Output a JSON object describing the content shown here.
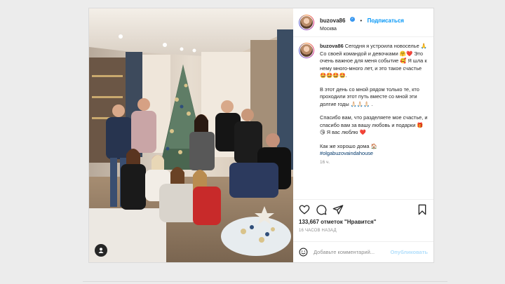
{
  "header": {
    "username": "buzova86",
    "dot": "•",
    "follow_label": "Подписаться",
    "location": "Москва"
  },
  "caption": {
    "username": "buzova86",
    "p1": "Сегодня я устроила новоселье 🙏 Со своей командой и девочками 🤗❤️ Это очень важное для меня событие 🥰 Я шла к нему много-много лет, и это такое счастье 🤩🤩🤩🤩.",
    "p2": "В этот день со мной рядом только те, кто проходили этот путь вместе со мной эти долгие годы 🙏🏻🙏🏻🙏🏻 .",
    "p3": "Спасибо вам, что разделяете мое счастье, и спасибо вам за вашу любовь и подарки 🎁😘 Я вас люблю ❤️",
    "p4": "Как же хорошо дома 🏠",
    "hashtag": "#olgabuzovaindahouse",
    "time": "16 ч."
  },
  "likes": "133,667 отметок \"Нравится\"",
  "time_ago": "16 ЧАСОВ НАЗАД",
  "comment": {
    "placeholder": "Добавьте комментарий...",
    "publish_label": "Опубликовать"
  },
  "icons": {
    "verified": "verified-badge-icon",
    "like": "heart-icon",
    "comment": "comment-icon",
    "share": "share-icon",
    "save": "bookmark-icon",
    "emoji": "smiley-icon",
    "tag": "person-tag-icon"
  },
  "colors": {
    "follow": "#0095f6",
    "publish_disabled": "#b2dffc",
    "hashtag": "#00376b"
  }
}
